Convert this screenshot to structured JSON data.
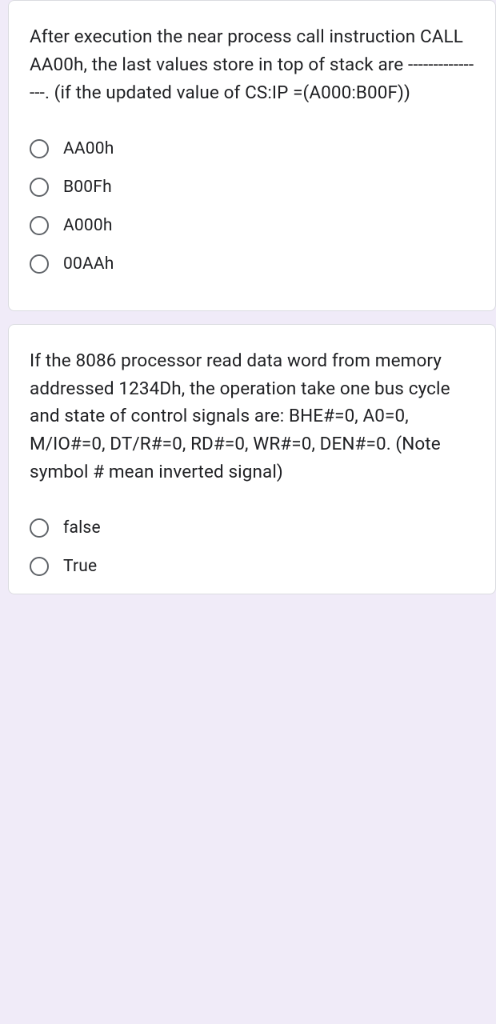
{
  "questions": [
    {
      "text": "After execution the near process call instruction CALL AA00h, the last values store in top of stack are ----------------. (if the updated value of CS:IP =(A000:B00F))",
      "options": [
        {
          "label": "AA00h"
        },
        {
          "label": "B00Fh"
        },
        {
          "label": "A000h"
        },
        {
          "label": "00AAh"
        }
      ]
    },
    {
      "text": "If the 8086 processor read data word from memory addressed 1234Dh, the operation take one bus cycle and state of control signals are: BHE#=0, A0=0, M/IO#=0, DT/R#=0, RD#=0, WR#=0, DEN#=0. (Note symbol # mean inverted signal)",
      "options": [
        {
          "label": "false"
        },
        {
          "label": "True"
        }
      ]
    }
  ]
}
